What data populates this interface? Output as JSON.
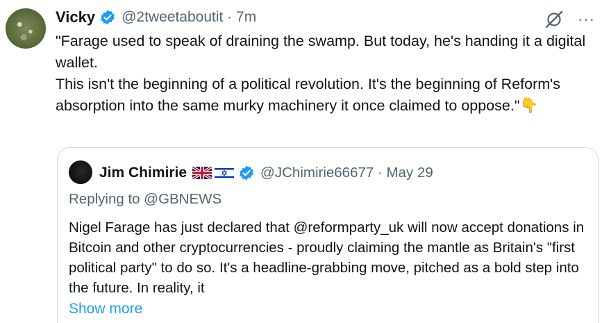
{
  "tweet": {
    "author_name": "Vicky",
    "handle_time": "@2tweetaboutit · 7m",
    "text_p1": "\"Farage used to speak of draining the swamp. But today, he's handing it a digital wallet.",
    "text_p2": "This isn't the beginning of a political revolution. It's the beginning of Reform's absorption into the same murky machinery it once claimed to oppose.\"",
    "emoji": "👇"
  },
  "quote": {
    "author_name": "Jim Chimirie",
    "handle_time": "@JChimirie66677 · May 29",
    "replying": "Replying to @GBNEWS",
    "text": "Nigel Farage has just declared that @reformparty_uk will now accept donations in Bitcoin and other cryptocurrencies - proudly claiming the mantle as Britain's \"first political party\" to do so. It's a headline-grabbing move, pitched as a bold step into the future. In reality, it",
    "show_more": "Show more"
  },
  "icons": {
    "more": "···",
    "grok": "grok-icon",
    "verified": "verified-badge-icon",
    "flags": [
      "uk-flag-icon",
      "israel-flag-icon"
    ]
  },
  "colors": {
    "link": "#1d9bf0",
    "secondary_text": "#536471",
    "border": "#cfd9de",
    "verified": "#1d9bf0"
  }
}
